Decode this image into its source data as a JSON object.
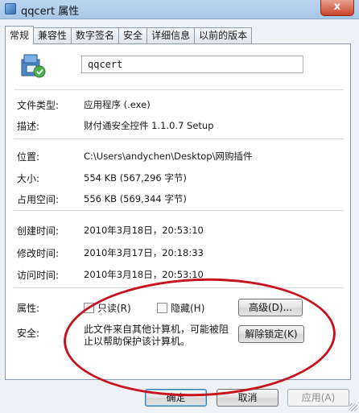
{
  "window": {
    "title": "qqcert 属性",
    "close_glyph": "x"
  },
  "tabs": [
    {
      "label": "常规",
      "active": true
    },
    {
      "label": "兼容性"
    },
    {
      "label": "数字签名"
    },
    {
      "label": "安全"
    },
    {
      "label": "详细信息"
    },
    {
      "label": "以前的版本"
    }
  ],
  "general": {
    "file_name": "qqcert",
    "file_icon": "installer-package-icon",
    "type_label": "文件类型:",
    "type_value": "应用程序 (.exe)",
    "desc_label": "描述:",
    "desc_value": "财付通安全控件 1.1.0.7 Setup",
    "location_label": "位置:",
    "location_value": "C:\\Users\\andychen\\Desktop\\网购插件",
    "size_label": "大小:",
    "size_value": "554 KB (567,296 字节)",
    "disk_label": "占用空间:",
    "disk_value": "556 KB (569,344 字节)",
    "created_label": "创建时间:",
    "created_value": "2010年3月18日，20:53:10",
    "modified_label": "修改时间:",
    "modified_value": "2010年3月17日，20:18:33",
    "accessed_label": "访问时间:",
    "accessed_value": "2010年3月18日，20:53:10",
    "attributes_label": "属性:",
    "readonly_label": "只读(R)",
    "readonly_checked": false,
    "hidden_label": "隐藏(H)",
    "hidden_checked": false,
    "advanced_button": "高级(D)...",
    "security_label": "安全:",
    "security_text": "此文件来自其他计算机，可能被阻止以帮助保护该计算机。",
    "unblock_button": "解除锁定(K)"
  },
  "footer": {
    "ok_button": "确定",
    "cancel_button": "取消",
    "apply_button": "应用(A)"
  },
  "annotation_color": "#c8141e"
}
